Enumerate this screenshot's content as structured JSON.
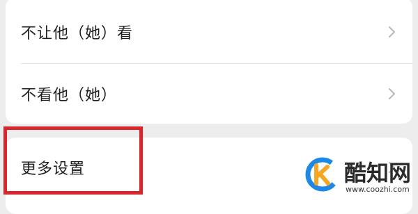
{
  "settings": {
    "items": [
      {
        "label": "不让他（她）看",
        "icon": "chevron-right-icon"
      },
      {
        "label": "不看他（她）",
        "icon": "chevron-right-icon"
      },
      {
        "label": "更多设置",
        "icon": "chevron-right-icon"
      }
    ]
  },
  "watermark": {
    "name": "酷知网",
    "url": "www.coozhi.com"
  },
  "colors": {
    "background": "#ededed",
    "card": "#ffffff",
    "highlight": "#d8262c",
    "logo_blue": "#1e88e5",
    "logo_orange": "#f5a623"
  }
}
